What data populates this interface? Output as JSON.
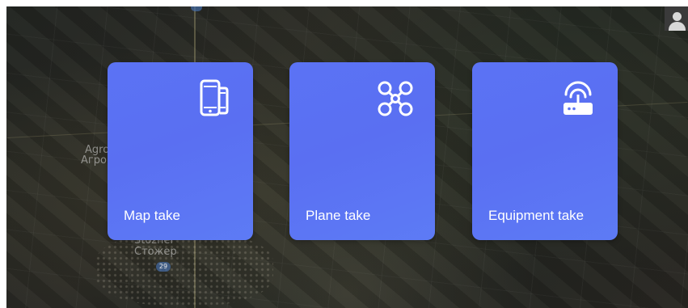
{
  "map": {
    "labels": [
      "Agro",
      "Агро",
      "Stozher",
      "Стожер"
    ],
    "road_badge": "29"
  },
  "cards": [
    {
      "id": "map",
      "label": "Map take",
      "icon": "phone-tablet-icon"
    },
    {
      "id": "plane",
      "label": "Plane take",
      "icon": "drone-icon"
    },
    {
      "id": "equipment",
      "label": "Equipment take",
      "icon": "wifi-router-icon"
    }
  ],
  "colors": {
    "card_background": "#5b73f4",
    "card_text": "#ffffff",
    "map_background": "#262723"
  }
}
